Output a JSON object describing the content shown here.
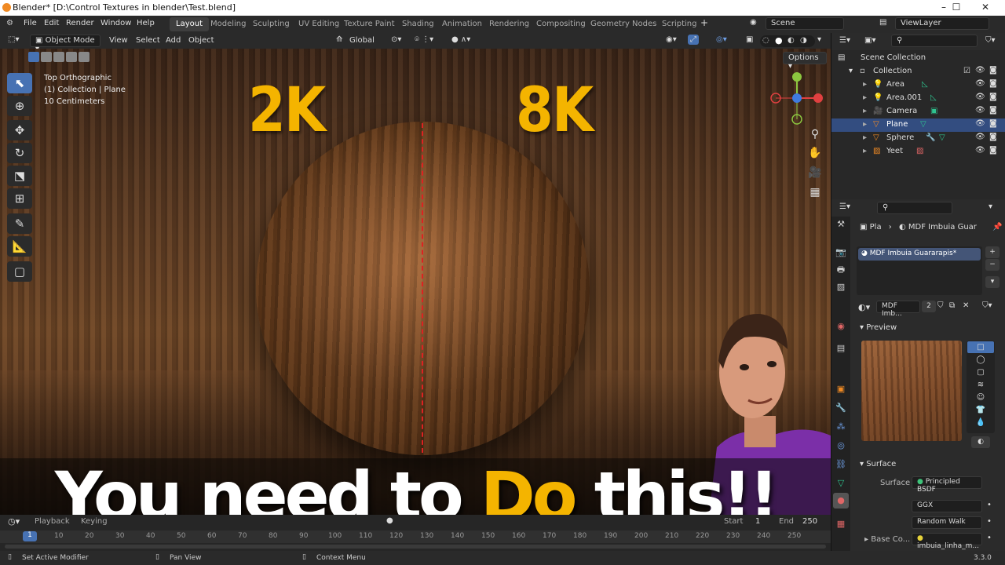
{
  "window": {
    "title": "Blender* [D:\\Control Textures in blender\\Test.blend]"
  },
  "menu": [
    "File",
    "Edit",
    "Render",
    "Window",
    "Help"
  ],
  "workspaces": [
    "Layout",
    "Modeling",
    "Sculpting",
    "UV Editing",
    "Texture Paint",
    "Shading",
    "Animation",
    "Rendering",
    "Compositing",
    "Geometry Nodes",
    "Scripting"
  ],
  "scene": {
    "name": "Scene",
    "view_layer": "ViewLayer"
  },
  "header": {
    "mode": "Object Mode",
    "view": "View",
    "select": "Select",
    "add": "Add",
    "object": "Object",
    "orientation": "Global",
    "options": "Options"
  },
  "viewport": {
    "info_view": "Top Orthographic",
    "info_collection": "(1) Collection | Plane",
    "info_scale": "10 Centimeters",
    "label_left": "2K",
    "label_right": "8K",
    "caption_a": "You need to ",
    "caption_b": "Do",
    "caption_c": " this!!"
  },
  "outliner": {
    "root": "Scene Collection",
    "collection": "Collection",
    "items": [
      "Area",
      "Area.001",
      "Camera",
      "Plane",
      "Sphere",
      "Yeet"
    ]
  },
  "properties": {
    "breadcrumb_object": "Pla",
    "breadcrumb_material": "MDF Imbuia Guar",
    "material_slot": "MDF Imbuia Guararapis*",
    "material_field": "MDF Imb...",
    "user_count": "2",
    "preview_label": "Preview",
    "surface_section": "Surface",
    "surface_label": "Surface",
    "surface_value": "Principled BSDF",
    "distribution": "GGX",
    "subsurface": "Random Walk",
    "base_color_label": "Base Co...",
    "base_color_value": "imbuia_linha_m..."
  },
  "timeline": {
    "playback": "Playback",
    "keying": "Keying",
    "start_label": "Start",
    "start": "1",
    "end_label": "End",
    "end": "250",
    "current": "1",
    "ticks": [
      "10",
      "20",
      "30",
      "40",
      "50",
      "60",
      "70",
      "80",
      "90",
      "100",
      "110",
      "120",
      "130",
      "140",
      "150",
      "160",
      "170",
      "180",
      "190",
      "200",
      "210",
      "220",
      "230",
      "240",
      "250"
    ]
  },
  "status": {
    "left": "Set Active Modifier",
    "middle": "Pan View",
    "right": "Context Menu",
    "version": "3.3.0"
  },
  "colors": {
    "accent": "#4772b3",
    "highlight": "#f4b400",
    "selection": "#334d80"
  }
}
